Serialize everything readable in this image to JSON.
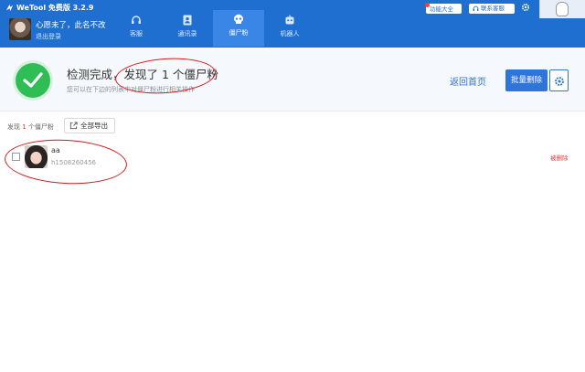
{
  "app": {
    "title": "WeTool 免费版 3.2.9"
  },
  "user": {
    "name": "心愿未了，此名不改",
    "logout": "退出登录"
  },
  "tabs": [
    {
      "label": "客服",
      "icon": "headset-icon"
    },
    {
      "label": "通讯录",
      "icon": "contacts-icon"
    },
    {
      "label": "僵尸粉",
      "icon": "skull-icon",
      "active": true
    },
    {
      "label": "机器人",
      "icon": "robot-icon"
    }
  ],
  "topright": {
    "features": "功能大全",
    "service": "联系客服"
  },
  "result": {
    "title": "检测完成，发现了 1 个僵尸粉",
    "subtitle": "您可以在下边的列表中对僵尸粉进行相关操作",
    "back": "返回首页",
    "batch_delete": "批量删除"
  },
  "list": {
    "found_prefix": "发现",
    "found_count": "1",
    "found_suffix": "个僵尸粉",
    "export": "全部导出",
    "items": [
      {
        "name": "aa",
        "id": "h1508260456",
        "status": "被删除"
      }
    ]
  },
  "colors": {
    "primary": "#1f6fd1",
    "success": "#2fbd55",
    "danger": "#e03a3a"
  }
}
